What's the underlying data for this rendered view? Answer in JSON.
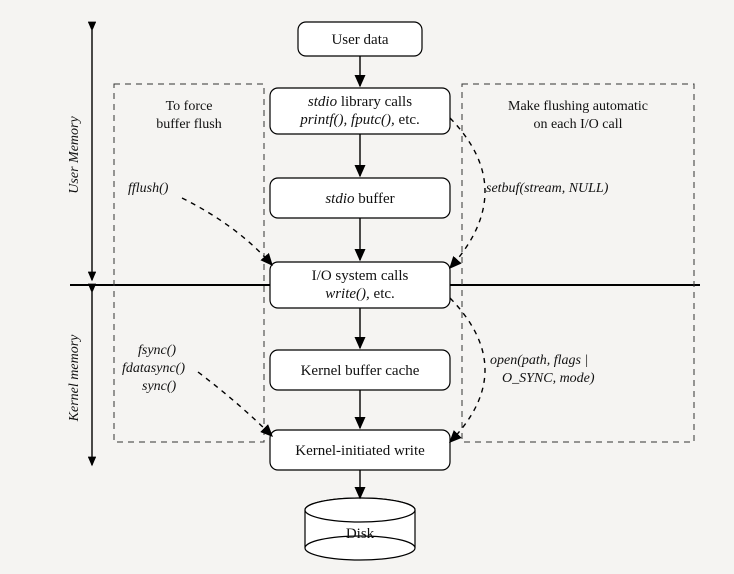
{
  "regions": {
    "user_memory_label": "User Memory",
    "kernel_memory_label": "Kernel memory"
  },
  "nodes": {
    "user_data": {
      "label": "User data"
    },
    "stdio_calls": {
      "line1_prefix": "stdio",
      "line1_suffix": " library calls",
      "line2": "printf(), fputc(), ",
      "line2_suffix": "etc."
    },
    "stdio_buffer": {
      "prefix": "stdio",
      "suffix": " buffer"
    },
    "io_syscalls": {
      "line1": "I/O system calls",
      "line2": "write(), ",
      "line2_suffix": "etc."
    },
    "kernel_cache": {
      "label": "Kernel buffer cache"
    },
    "kernel_write": {
      "label": "Kernel-initiated write"
    },
    "disk": {
      "label": "Disk"
    }
  },
  "left_box": {
    "title_line1": "To force",
    "title_line2": "buffer flush",
    "fflush": "fflush()",
    "fsync": "fsync()",
    "fdatasync": "fdatasync()",
    "sync": "sync()"
  },
  "right_box": {
    "title_line1": "Make flushing automatic",
    "title_line2": "on each I/O call",
    "setbuf": "setbuf(stream, NULL)",
    "open_line1": "open(path, flags |",
    "open_line2": "O_SYNC, mode)"
  }
}
